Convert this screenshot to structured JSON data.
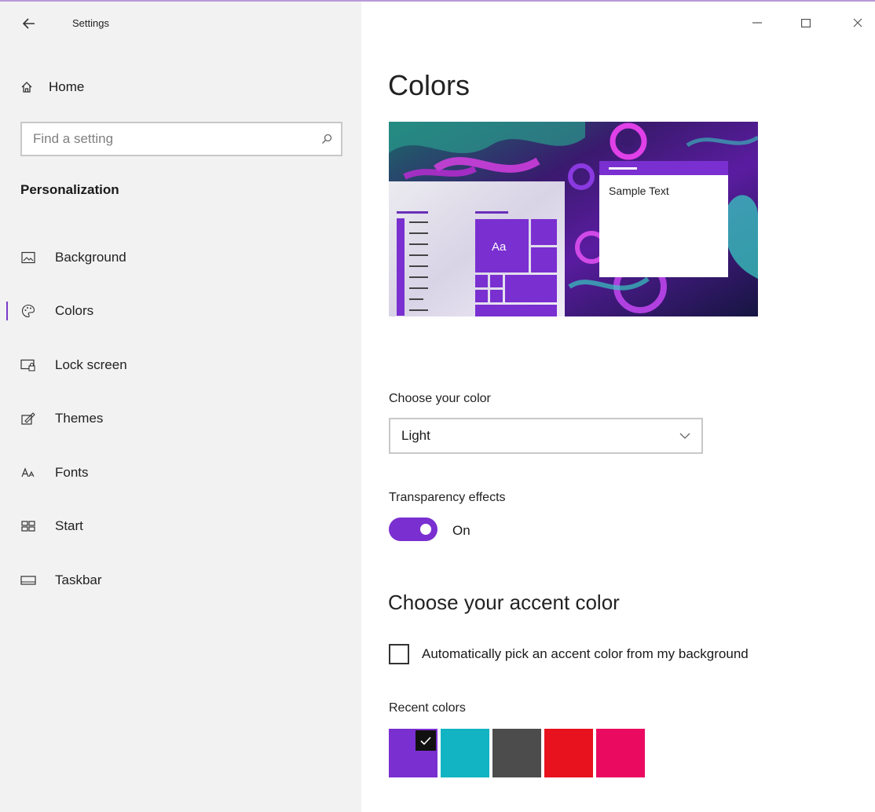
{
  "titlebar": {
    "title": "Settings",
    "minimize": "–",
    "maximize": "☐",
    "close": "✕"
  },
  "sidebar": {
    "home_label": "Home",
    "search_placeholder": "Find a setting",
    "section_title": "Personalization",
    "items": [
      {
        "label": "Background",
        "icon": "picture-icon"
      },
      {
        "label": "Colors",
        "icon": "palette-icon",
        "active": true
      },
      {
        "label": "Lock screen",
        "icon": "lock-screen-icon"
      },
      {
        "label": "Themes",
        "icon": "themes-icon"
      },
      {
        "label": "Fonts",
        "icon": "fonts-icon"
      },
      {
        "label": "Start",
        "icon": "start-icon"
      },
      {
        "label": "Taskbar",
        "icon": "taskbar-icon"
      }
    ]
  },
  "main": {
    "title": "Colors",
    "preview": {
      "sample_text": "Sample Text",
      "tile_label": "Aa"
    },
    "choose_color": {
      "label": "Choose your color",
      "value": "Light"
    },
    "transparency": {
      "label": "Transparency effects",
      "state": "On",
      "enabled": true
    },
    "accent": {
      "heading": "Choose your accent color",
      "auto_pick_label": "Automatically pick an accent color from my background",
      "auto_pick_checked": false,
      "recent_label": "Recent colors",
      "recent_colors": [
        "#7a2fd0",
        "#12b3c2",
        "#4c4c4c",
        "#e8121f",
        "#ea0b60"
      ],
      "selected_index": 0
    }
  },
  "colors": {
    "accent": "#7a2fd0",
    "sidebar_bg": "#f2f2f2"
  }
}
